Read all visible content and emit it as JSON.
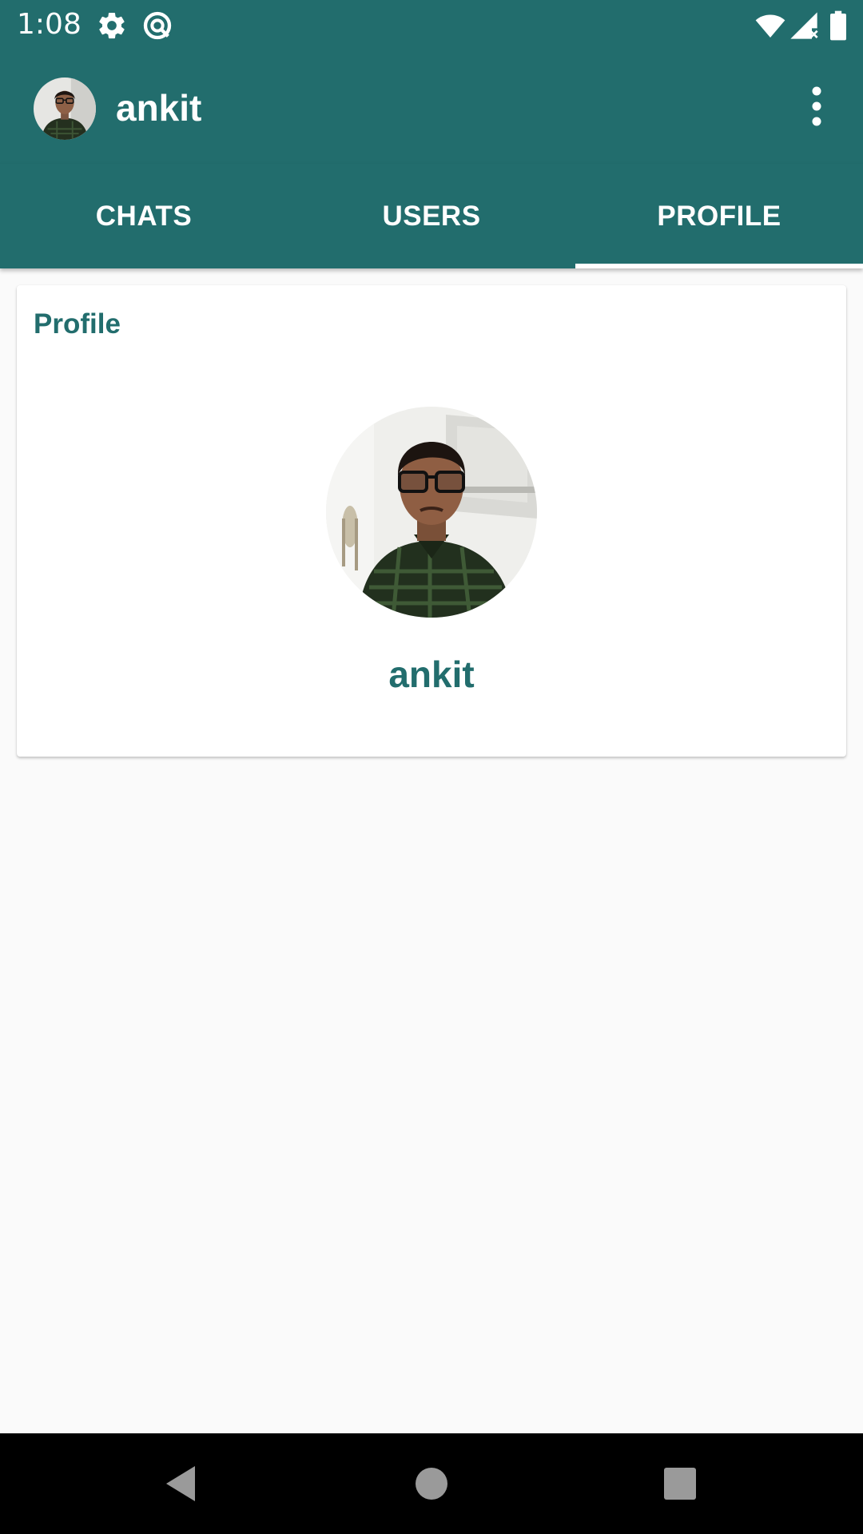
{
  "status_bar": {
    "time": "1:08",
    "icons": [
      "gear-icon",
      "data-saver-icon",
      "wifi-icon",
      "signal-icon",
      "battery-icon"
    ]
  },
  "app_bar": {
    "title": "ankit",
    "avatar": "user-avatar",
    "menu_icon": "more-vert-icon"
  },
  "tabs": [
    {
      "label": "CHATS",
      "selected": false
    },
    {
      "label": "USERS",
      "selected": false
    },
    {
      "label": "PROFILE",
      "selected": true
    }
  ],
  "profile_card": {
    "title": "Profile",
    "name": "ankit",
    "photo": "profile-photo"
  },
  "nav_bar": {
    "buttons": [
      "back-icon",
      "home-icon",
      "recents-icon"
    ]
  },
  "colors": {
    "primary": "#226d6d",
    "background": "#fafafa",
    "card": "#ffffff"
  }
}
